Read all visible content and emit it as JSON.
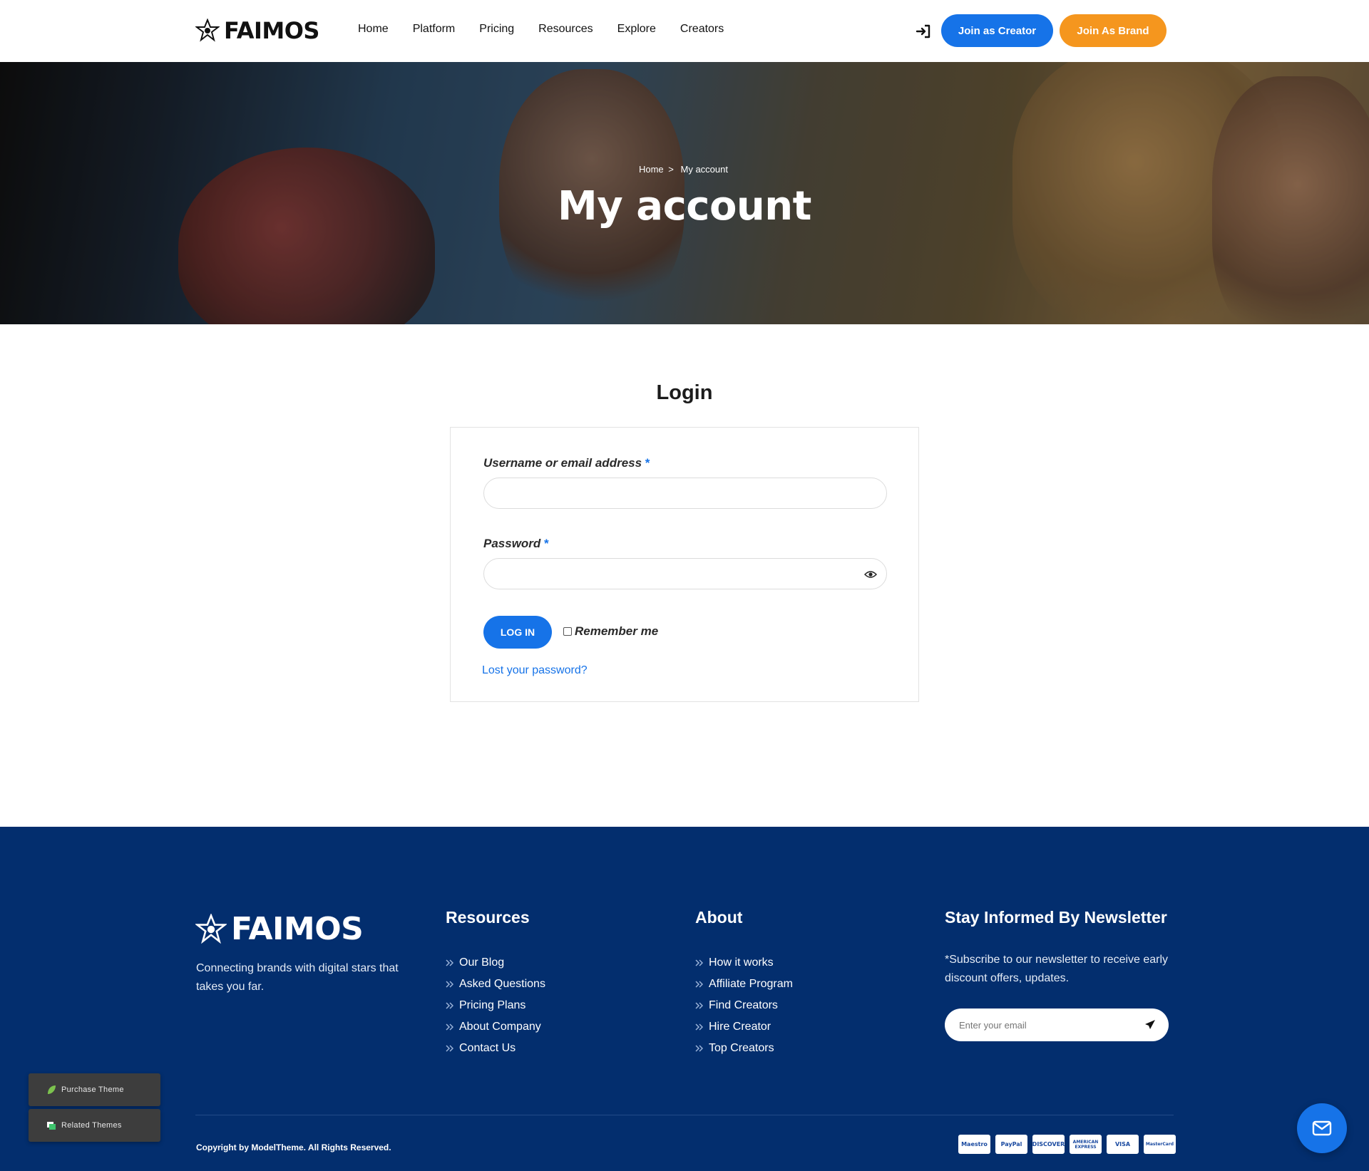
{
  "header": {
    "brand": "FAIMOS",
    "nav": [
      "Home",
      "Platform",
      "Pricing",
      "Resources",
      "Explore",
      "Creators"
    ],
    "join_creator": "Join as Creator",
    "join_brand": "Join As Brand"
  },
  "hero": {
    "breadcrumb_home": "Home",
    "breadcrumb_sep": ">",
    "breadcrumb_current": "My account",
    "title": "My account"
  },
  "login": {
    "heading": "Login",
    "username_label": "Username or email address",
    "password_label": "Password",
    "required_mark": "*",
    "username_value": "",
    "password_value": "",
    "submit_label": "LOG IN",
    "remember_label": "Remember me",
    "remember_checked": false,
    "lost_password": "Lost your password?"
  },
  "footer": {
    "brand": "FAIMOS",
    "tagline": "Connecting brands with digital stars that takes you far.",
    "resources_title": "Resources",
    "resources": [
      "Our Blog",
      "Asked Questions",
      "Pricing Plans",
      "About Company",
      "Contact Us"
    ],
    "about_title": "About",
    "about": [
      "How it works",
      "Affiliate Program",
      "Find Creators",
      "Hire Creator",
      "Top Creators"
    ],
    "newsletter_title": "Stay Informed By Newsletter",
    "newsletter_text": "*Subscribe to our newsletter to receive early discount offers, updates.",
    "email_placeholder": "Enter your email",
    "copyright": "Copyright by ModelTheme. All Rights Reserved.",
    "payment_methods": [
      "Maestro",
      "PayPal",
      "DISCOVER",
      "AMERICAN EXPRESS",
      "VISA",
      "MasterCard"
    ]
  },
  "floating": {
    "purchase": "Purchase Theme",
    "related": "Related Themes"
  },
  "colors": {
    "primary": "#1673e8",
    "brand_orange": "#f5961e",
    "footer_bg": "#032e6e"
  },
  "icons": [
    "login-icon",
    "eye-icon",
    "chevron-double-right-icon",
    "send-icon",
    "leaf-icon",
    "layers-icon",
    "mail-icon"
  ]
}
